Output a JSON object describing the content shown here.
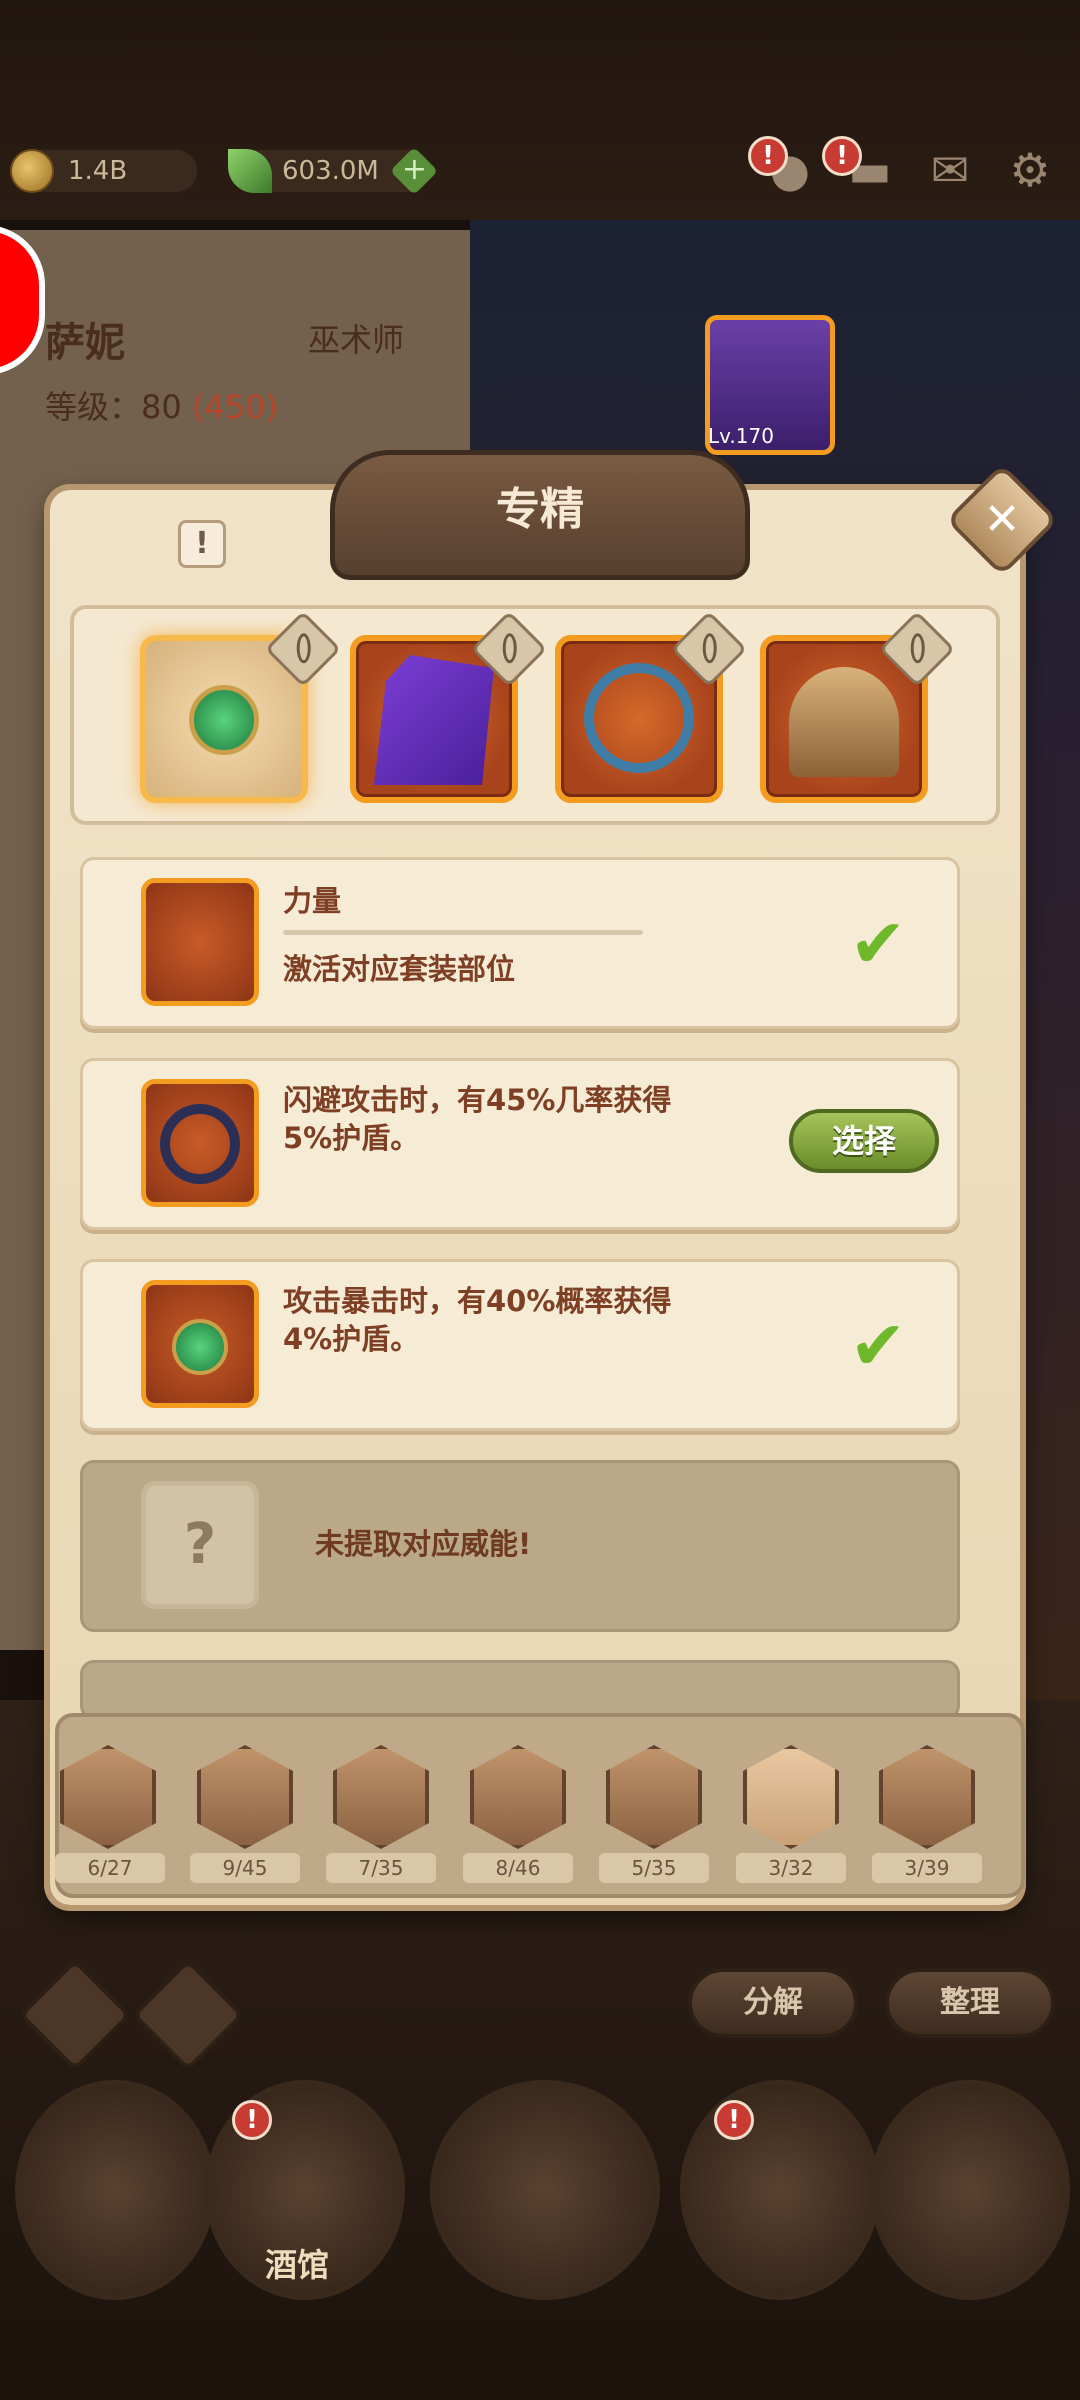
{
  "resources": {
    "gold": "1.4B",
    "gems": "603.0M"
  },
  "hero": {
    "name": "萨妮",
    "class": "巫术师",
    "level_label": "等级：80",
    "level_extra": "(450)",
    "hero_level": "Lv.170"
  },
  "dialog": {
    "title": "专精",
    "rows": [
      {
        "title": "力量",
        "desc": "激活对应套装部位",
        "status": "checked"
      },
      {
        "text_line1": "闪避攻击时，有45%几率获得",
        "text_line2": "5%护盾。",
        "button": "选择"
      },
      {
        "text_line1": "攻击暴击时，有40%概率获得",
        "text_line2": "4%护盾。",
        "status": "checked"
      },
      {
        "locked_text": "未提取对应威能!"
      }
    ],
    "question_mark": "?",
    "check_mark": "✔",
    "info_mark": "!",
    "close_mark": "✕"
  },
  "tabs": [
    {
      "count": "6/27"
    },
    {
      "count": "9/45"
    },
    {
      "count": "7/35"
    },
    {
      "count": "8/46"
    },
    {
      "count": "5/35"
    },
    {
      "count": "3/32"
    },
    {
      "count": "3/39"
    }
  ],
  "actions": {
    "decompose": "分解",
    "organize": "整理"
  },
  "bottom_nav": {
    "tavern": "酒馆"
  },
  "colors": {
    "accent_orange": "#f39c1f",
    "check_green": "#6fb72b",
    "select_green": "#6a8d2a",
    "text_brown": "#7e3f25"
  }
}
